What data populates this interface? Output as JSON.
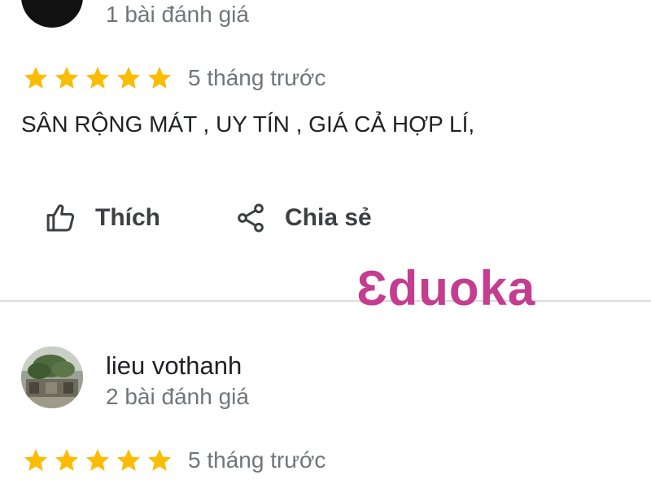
{
  "colors": {
    "star": "#fbbc04",
    "watermark": "#c43d8e",
    "divider": "#dadce0",
    "secondary_text": "#70757a"
  },
  "reviews": [
    {
      "reviewer_name": "",
      "review_count": "1 bài đánh giá",
      "rating": 5,
      "time_ago": "5 tháng trước",
      "text": "SÂN RỘNG MÁT , UY TÍN , GIÁ CẢ HỢP LÍ,",
      "actions": {
        "like_label": "Thích",
        "like_icon": "thumbs-up-icon",
        "share_label": "Chia sẻ",
        "share_icon": "share-icon"
      }
    },
    {
      "reviewer_name": "lieu vothanh",
      "review_count": "2 bài đánh giá",
      "rating": 5,
      "time_ago": "5 tháng trước"
    }
  ],
  "watermark": {
    "text": "Ɛduoka"
  }
}
